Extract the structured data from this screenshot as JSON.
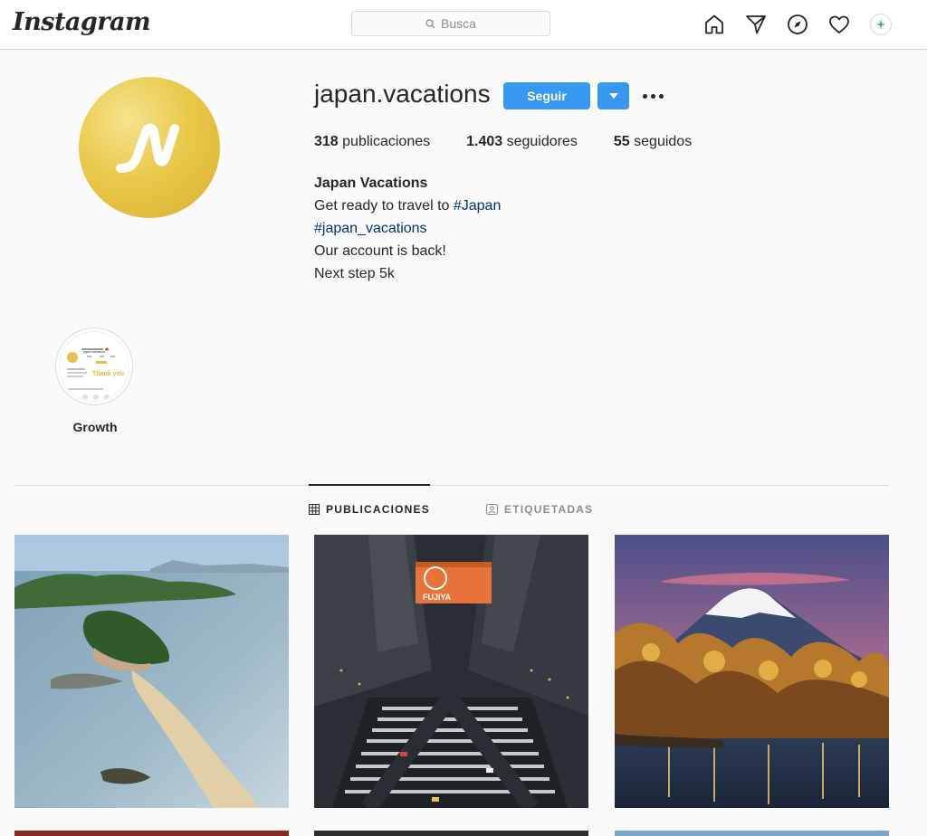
{
  "app": {
    "logo_text": "Instagram"
  },
  "search": {
    "placeholder": "Busca",
    "icon": "search-icon"
  },
  "nav": {
    "icons": [
      "home-icon",
      "direct-icon",
      "explore-icon",
      "activity-heart-icon",
      "profile-avatar-icon"
    ]
  },
  "profile": {
    "username": "japan.vacations",
    "follow_label": "Seguir",
    "stats": {
      "posts_count": "318",
      "posts_label": "publicaciones",
      "followers_count": "1.403",
      "followers_label": "seguidores",
      "following_count": "55",
      "following_label": "seguidos"
    },
    "bio": {
      "name": "Japan Vacations",
      "line1_prefix": "Get ready to travel to ",
      "line1_tag": "#Japan",
      "line2_tag": "#japan_vacations",
      "line3": "Our account is back!",
      "line4": "Next step 5k"
    },
    "colors": {
      "accent": "#3897f0",
      "hashtag": "#003569",
      "avatar_gold": "#e9c94b"
    }
  },
  "highlights": [
    {
      "label": "Growth",
      "thumb_text": "Thank you",
      "thumb_title": "japan.vacations"
    }
  ],
  "tabs": [
    {
      "label": "PUBLICACIONES",
      "icon": "grid-icon",
      "active": true
    },
    {
      "label": "ETIQUETADAS",
      "icon": "tagged-icon",
      "active": false
    }
  ],
  "posts": [
    {
      "name": "island-beach-photo"
    },
    {
      "name": "city-crossing-photo",
      "sign_text": "FUJIYA"
    },
    {
      "name": "fuji-autumn-photo"
    }
  ]
}
